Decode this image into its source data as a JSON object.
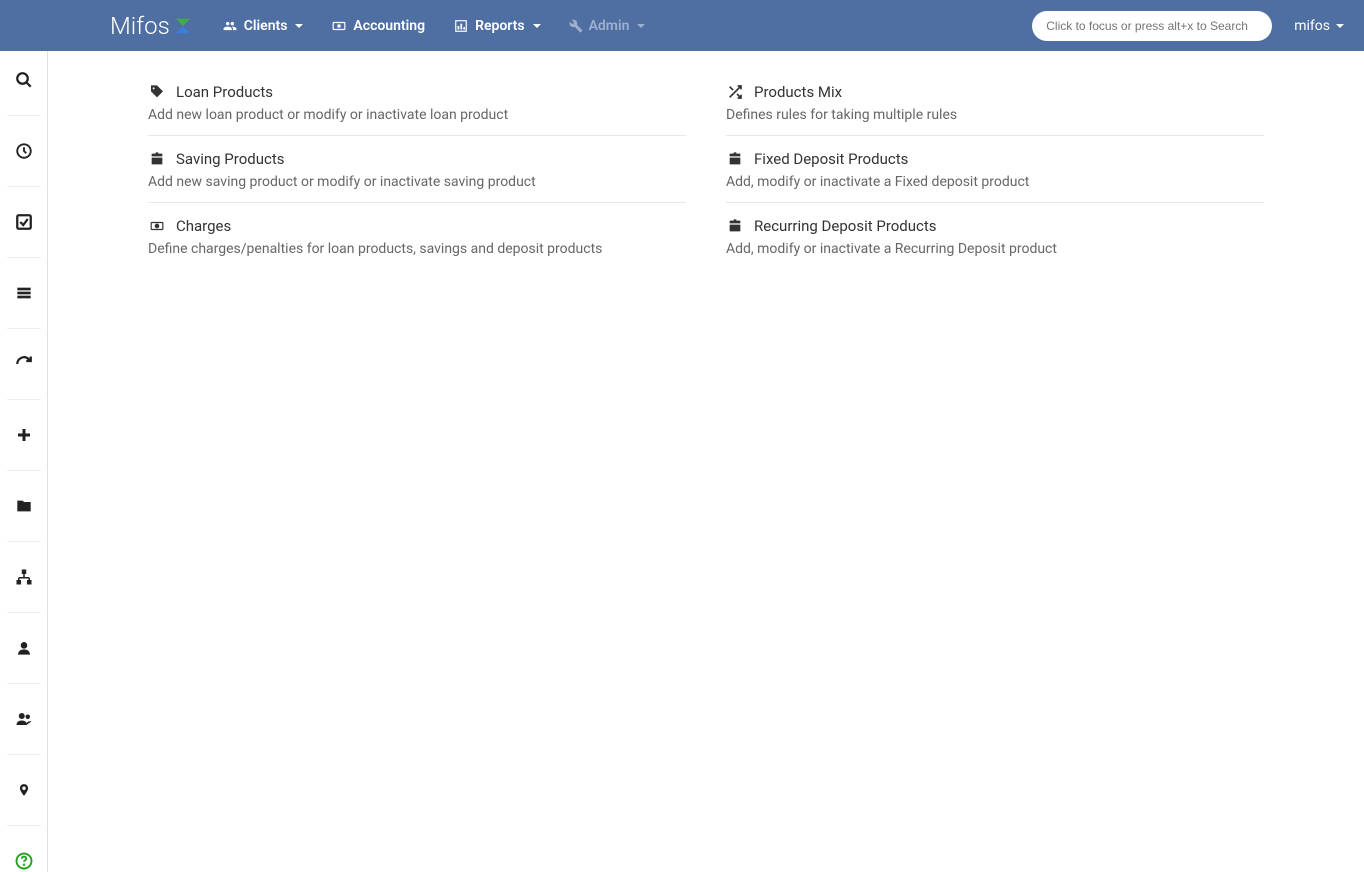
{
  "header": {
    "brand": "Mifos",
    "nav": {
      "clients": "Clients",
      "accounting": "Accounting",
      "reports": "Reports",
      "admin": "Admin"
    },
    "search_placeholder": "Click to focus or press alt+x to Search",
    "user": "mifos"
  },
  "left": [
    {
      "title": "Loan Products",
      "desc": "Add new loan product or modify or inactivate loan product",
      "icon": "tag"
    },
    {
      "title": "Saving Products",
      "desc": "Add new saving product or modify or inactivate saving product",
      "icon": "briefcase"
    },
    {
      "title": "Charges",
      "desc": "Define charges/penalties for loan products, savings and deposit products",
      "icon": "money"
    }
  ],
  "right": [
    {
      "title": "Products Mix",
      "desc": "Defines rules for taking multiple rules",
      "icon": "shuffle"
    },
    {
      "title": "Fixed Deposit Products",
      "desc": "Add, modify or inactivate a Fixed deposit product",
      "icon": "briefcase"
    },
    {
      "title": "Recurring Deposit Products",
      "desc": "Add, modify or inactivate a Recurring Deposit product",
      "icon": "briefcase"
    }
  ]
}
